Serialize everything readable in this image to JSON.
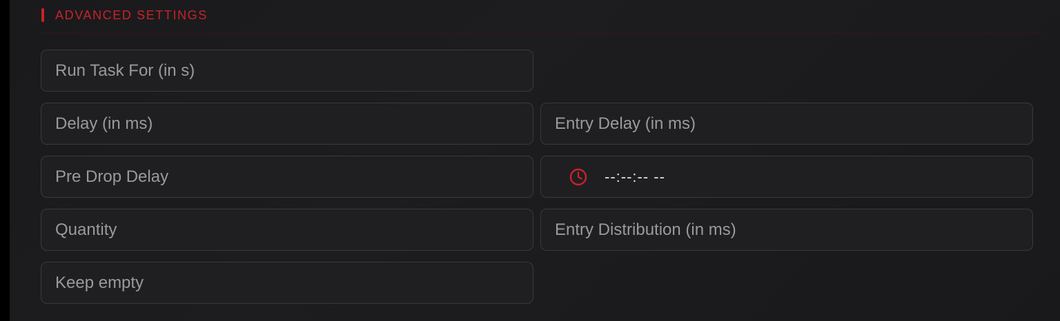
{
  "section": {
    "title": "ADVANCED SETTINGS"
  },
  "fields": {
    "run_task_for": {
      "placeholder": "Run Task For (in s)",
      "value": ""
    },
    "delay": {
      "placeholder": "Delay (in ms)",
      "value": ""
    },
    "entry_delay": {
      "placeholder": "Entry Delay (in ms)",
      "value": ""
    },
    "pre_drop_delay": {
      "placeholder": "Pre Drop Delay",
      "value": ""
    },
    "time": {
      "value": "--:--:-- --",
      "icon": "clock-icon"
    },
    "quantity": {
      "placeholder": "Quantity",
      "value": ""
    },
    "entry_distribution": {
      "placeholder": "Entry Distribution (in ms)",
      "value": ""
    },
    "keep_empty": {
      "placeholder": "Keep empty",
      "value": ""
    }
  },
  "colors": {
    "accent": "#c8222a",
    "field_bg": "#1f1f21",
    "field_border": "#3a3a3d",
    "placeholder": "#9a9a9a",
    "background": "#1b1b1d"
  }
}
